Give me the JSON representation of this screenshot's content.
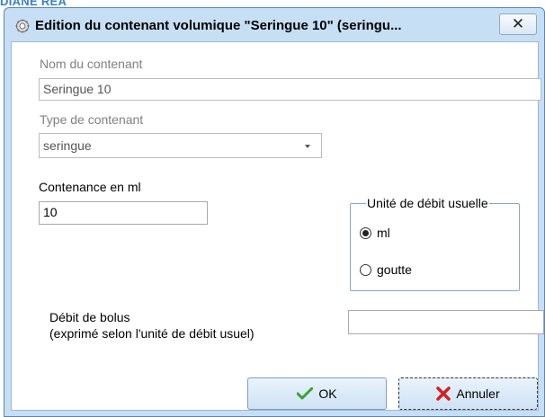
{
  "background": {
    "partial_text": "DIANE REA"
  },
  "window": {
    "title": "Edition du contenant volumique \"Seringue 10\" (seringu...",
    "close_glyph": "✕"
  },
  "fields": {
    "nom": {
      "label": "Nom du contenant",
      "value": "Seringue 10"
    },
    "type": {
      "label": "Type de contenant",
      "value": "seringue"
    },
    "contenance": {
      "label": "Contenance en ml",
      "value": "10"
    },
    "bolus": {
      "label_line1": "Débit de bolus",
      "label_line2": "(exprimé selon l'unité de débit usuel)",
      "value": ""
    }
  },
  "unit_group": {
    "legend": "Unité de débit usuelle",
    "options": [
      {
        "label": "ml",
        "selected": true
      },
      {
        "label": "goutte",
        "selected": false
      }
    ]
  },
  "buttons": {
    "ok": "OK",
    "cancel": "Annuler"
  },
  "colors": {
    "dialog_frame": "#c6dff4",
    "ok_check": "#3aa335",
    "cancel_x": "#d42020"
  }
}
